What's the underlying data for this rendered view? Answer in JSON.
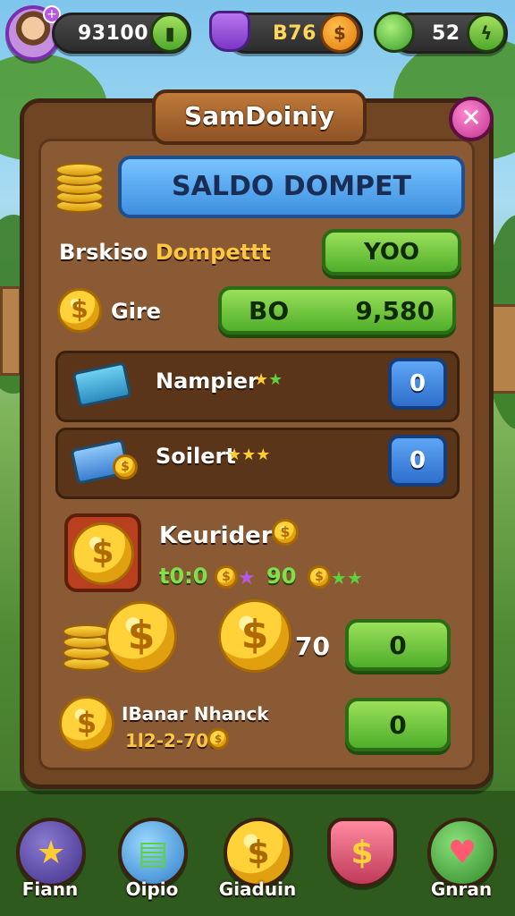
{
  "topbar": {
    "avatar_badge": "+",
    "coins_value": "93100",
    "gems_value": "B76",
    "energy_value": "52"
  },
  "panel": {
    "title": "SamDoiniy",
    "close_symbol": "✕",
    "banner": "SALDO DOMPET",
    "balance_label_white": "Brskiso ",
    "balance_label_gold": "Dompettt",
    "balance_button": "YOO",
    "gire_label": "Gire",
    "gire_left": "BO",
    "gire_right": "9,580",
    "row1_label": "Nampier",
    "row1_value": "0",
    "row2_label": "Soilert",
    "row2_value": "0",
    "reward_label": "Keurider i",
    "reward_stat1": "t0:0",
    "reward_stat2": "90",
    "big_coin_amount": "70",
    "big_coin_button": "0",
    "bottom_label": "IBanar Nhanck",
    "bottom_sub": "1l2-2-700",
    "bottom_button": "0"
  },
  "nav": {
    "items": [
      {
        "label": "Fiann",
        "icon": "star-icon",
        "color": "#4f3a9a"
      },
      {
        "label": "Oipio",
        "icon": "ticket-icon",
        "color": "#3a8fcf"
      },
      {
        "label": "Giaduin",
        "icon": "coin-icon",
        "color": "#e0a010"
      },
      {
        "label": "",
        "icon": "shield-icon",
        "color": "#d04a6a"
      },
      {
        "label": "Gnran",
        "icon": "heart-chat-icon",
        "color": "#3aa04a"
      }
    ]
  },
  "colors": {
    "panel": "#6f4524",
    "banner": "#3d8fe0",
    "green": "#4fae2a",
    "gold": "#ffd23a"
  }
}
